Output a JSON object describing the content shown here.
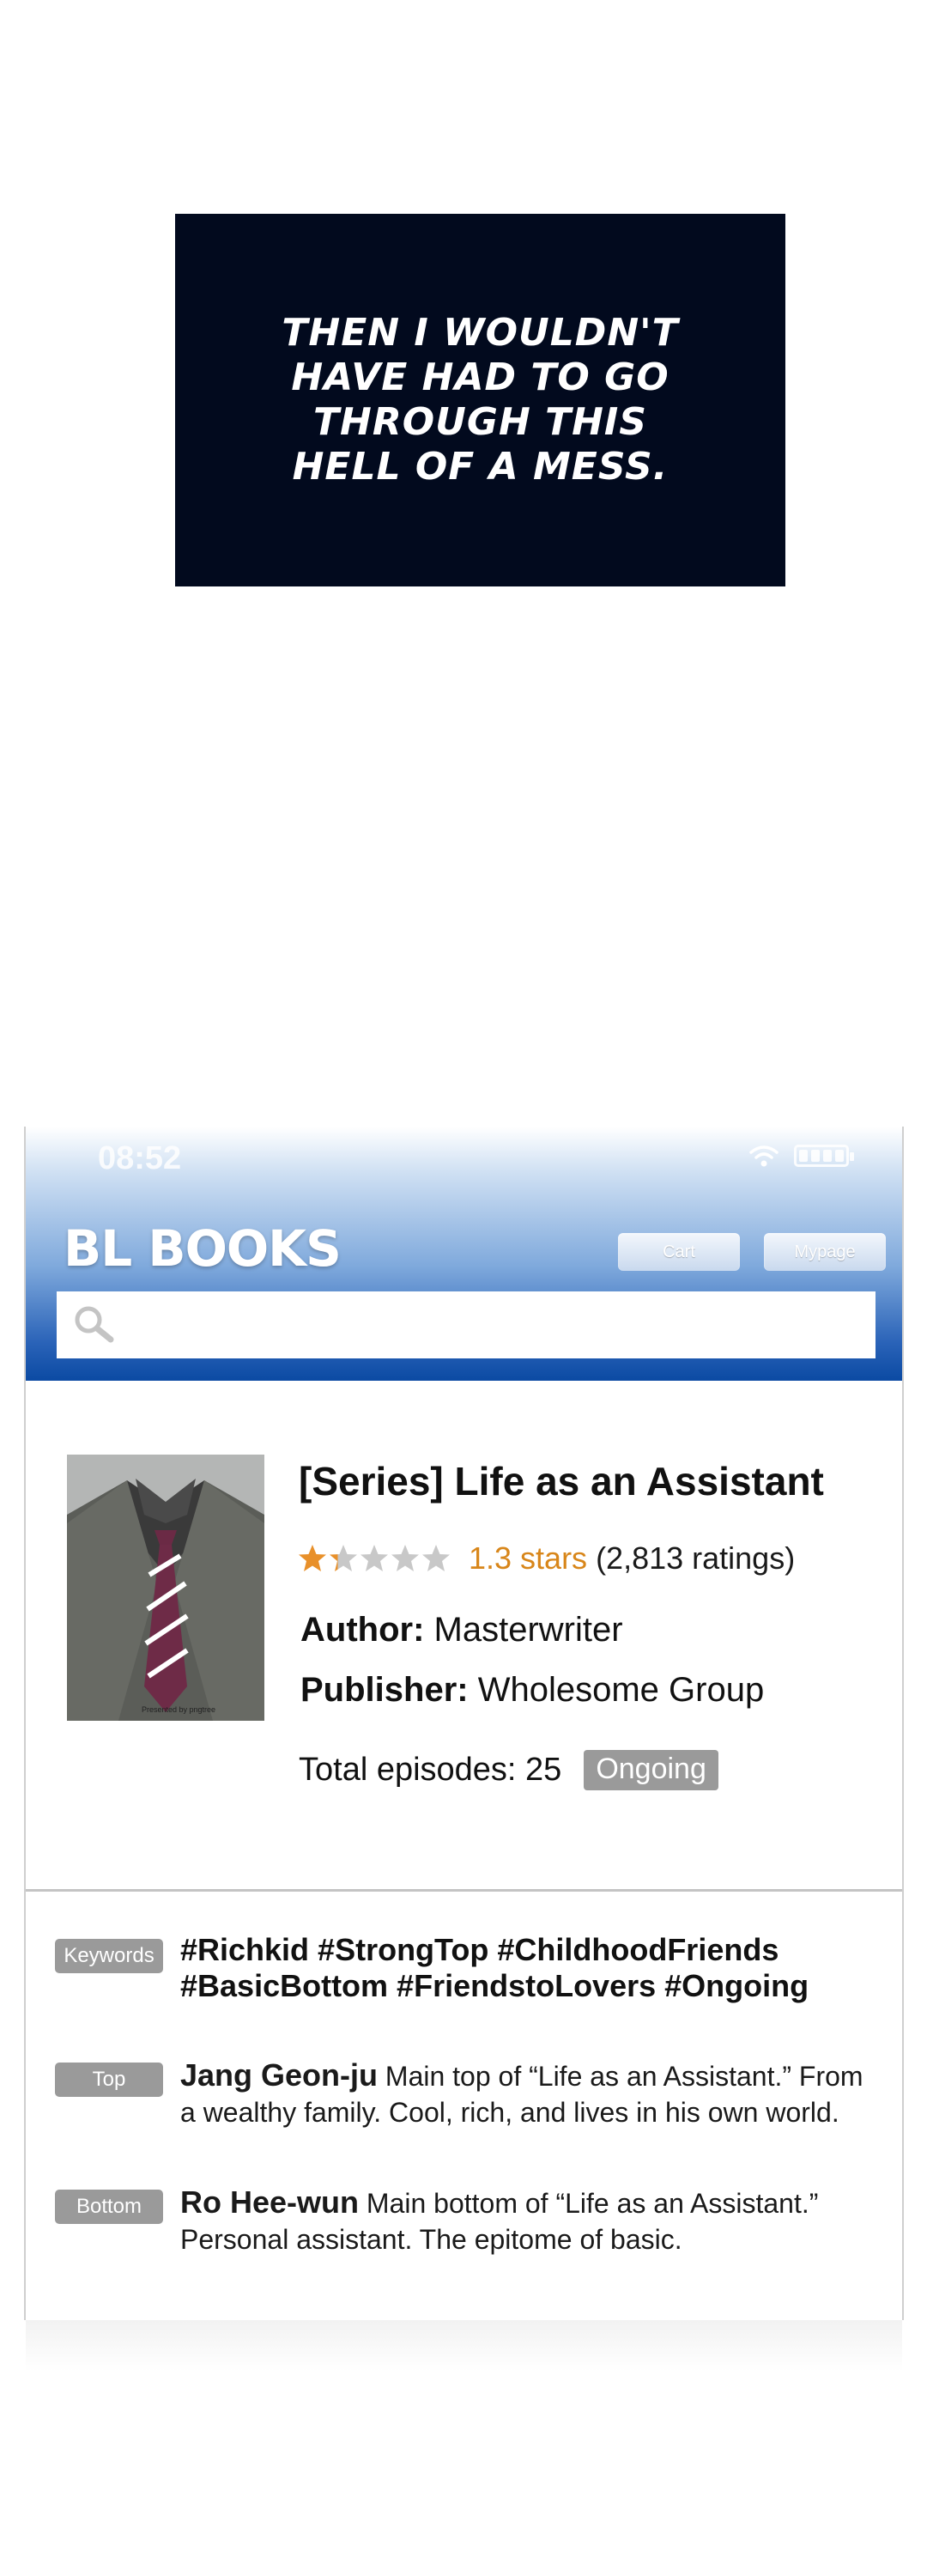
{
  "panel": {
    "text": "Then I wouldn't have had to go through this hell of a mess."
  },
  "status_bar": {
    "time": "08:52"
  },
  "header": {
    "brand": "BL BOOKS",
    "cart_label": "Cart",
    "mypage_label": "Mypage",
    "search_placeholder": ""
  },
  "book": {
    "title": "[Series] Life as an Assistant",
    "rating": 1.3,
    "rating_text": "1.3 stars",
    "ratings_count_text": "(2,813 ratings)",
    "author_label": "Author:",
    "author": "Masterwriter",
    "publisher_label": "Publisher:",
    "publisher": "Wholesome Group",
    "episodes_text": "Total episodes: 25",
    "status": "Ongoing",
    "cover_caption": "Presented by pngtree"
  },
  "details": {
    "keywords_label": "Keywords",
    "keywords_line1": "#Richkid #StrongTop #ChildhoodFriends",
    "keywords_line2": "#BasicBottom #FriendstoLovers #Ongoing",
    "top_label": "Top",
    "top_name": "Jang Geon-ju",
    "top_desc": "Main top of “Life as an Assistant.” From a wealthy family. Cool, rich, and lives in his own world.",
    "bottom_label": "Bottom",
    "bottom_name": "Ro Hee-wun",
    "bottom_desc": "Main bottom of “Life as an Assistant.” Personal assistant. The epitome of basic."
  },
  "colors": {
    "panel_bg": "#020a1e",
    "header_blue": "#0b4aa3",
    "star_filled": "#e8902a",
    "star_empty": "#c8c8c8",
    "rating_text": "#d8861a",
    "badge_gray": "#9a9a9a"
  }
}
